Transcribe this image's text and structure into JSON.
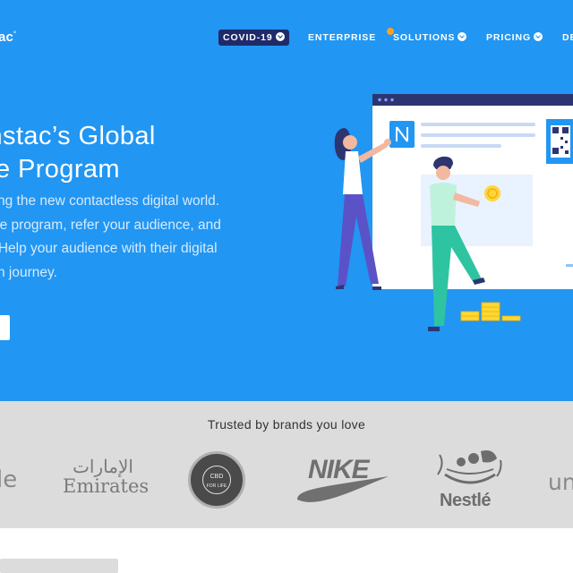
{
  "header": {
    "logo_text": "ac",
    "logo_mark": "°",
    "nav": [
      {
        "label": "COVID-19",
        "has_dropdown": true,
        "highlight": true
      },
      {
        "label": "ENTERPRISE",
        "has_dropdown": false
      },
      {
        "label": "SOLUTIONS",
        "has_dropdown": true,
        "badge_color": "#ff9f1c"
      },
      {
        "label": "PRICING",
        "has_dropdown": true
      },
      {
        "label": "DE",
        "has_dropdown": false
      }
    ]
  },
  "hero": {
    "title_line1": "onstac’s Global",
    "title_line2": "ate Program",
    "desc_line1": "vering the new contactless digital world.",
    "desc_line2": "filiate program, refer your audience, and",
    "desc_line3": "ue. Help your audience with their digital",
    "desc_line4": "ation journey."
  },
  "brands": {
    "title": "Trusted by brands you love",
    "items": [
      {
        "name": "le"
      },
      {
        "name": "Emirates",
        "arabic": "الإمارات"
      },
      {
        "name": "CBD FOR LIFE",
        "line1": "CBD",
        "line2": "FOR LIFE"
      },
      {
        "name": "NIKE"
      },
      {
        "name": "Nestlé"
      },
      {
        "name": "un"
      }
    ]
  },
  "colors": {
    "hero_bg": "#2196f3",
    "covid_bg": "#1f2a6b",
    "brands_bg": "#dcdcdc"
  }
}
